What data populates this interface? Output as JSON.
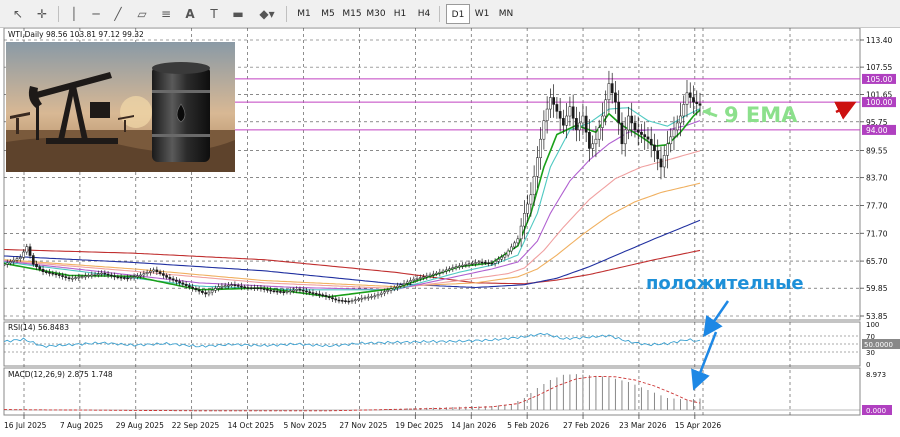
{
  "toolbar": {
    "icons": [
      "cursor-icon",
      "crosshair-icon",
      "vertical-line-icon",
      "horizontal-line-icon",
      "trendline-icon",
      "channel-icon",
      "text-icon",
      "text-label-icon",
      "rectangle-icon",
      "shapes-icon"
    ],
    "timeframes": [
      "M1",
      "M5",
      "M15",
      "M30",
      "H1",
      "H4",
      "D1",
      "W1",
      "MN"
    ],
    "active_timeframe": "D1"
  },
  "chart_header": "WTI,Daily  98.56 103.81 97.12 99.32",
  "annotations": {
    "ema_label": "9 EMA",
    "positive_label": "положителные",
    "ema_color": "#8ce08c",
    "positive_color": "#1e90d8"
  },
  "price_axis": {
    "ticks": [
      "113.40",
      "107.55",
      "101.65",
      "95.75",
      "89.55",
      "83.70",
      "77.70",
      "71.70",
      "65.70",
      "59.85",
      "53.85"
    ],
    "badges": [
      "105.00",
      "100.00",
      "94.00"
    ]
  },
  "rsi": {
    "label": "RSI(14) 56.8483",
    "ticks": [
      "100",
      "70",
      "30",
      "0"
    ],
    "badge": "50.0000"
  },
  "macd": {
    "label": "MACD(12,26,9) 2.875 1.748",
    "ticks": [
      "8.973"
    ],
    "badge": "0.000"
  },
  "time_axis": {
    "labels": [
      "16 Jul 2025",
      "7 Aug 2025",
      "29 Aug 2025",
      "22 Sep 2025",
      "14 Oct 2025",
      "5 Nov 2025",
      "27 Nov 2025",
      "19 Dec 2025",
      "14 Jan 2026",
      "5 Feb 2026",
      "27 Feb 2026",
      "23 Mar 2026",
      "15 Apr 2026"
    ]
  },
  "colors": {
    "horizontal_levels": "#c040c0",
    "badge_fill": "#b040c0",
    "arrow_red": "#cc1111",
    "arrow_blue": "#1e88e5",
    "candle": "#1a1a1a",
    "ema9": "#1aa01a",
    "ema_cyan": "#4fc9c2",
    "ema_violet": "#b060d0",
    "ema_pink": "#f0a0a0",
    "ema_orange": "#f0b060",
    "ema_navy": "#2030a0",
    "ema_red": "#c03030",
    "macd_signal": "#cc3333",
    "rsi_line": "#3aa0d0"
  },
  "chart_data": {
    "type": "line",
    "title": "WTI,Daily",
    "ohlc_header": {
      "open": 98.56,
      "high": 103.81,
      "low": 97.12,
      "close": 99.32
    },
    "x_labels": [
      "16 Jul 2025",
      "7 Aug 2025",
      "29 Aug 2025",
      "22 Sep 2025",
      "14 Oct 2025",
      "5 Nov 2025",
      "27 Nov 2025",
      "19 Dec 2025",
      "14 Jan 2026",
      "5 Feb 2026",
      "27 Feb 2026",
      "23 Mar 2026",
      "15 Apr 2026"
    ],
    "ylim": [
      53.85,
      113.4
    ],
    "levels": [
      105.0,
      100.0,
      94.0
    ],
    "close_path": [
      [
        0,
        65.0
      ],
      [
        5,
        66.5
      ],
      [
        7,
        68.8
      ],
      [
        9,
        65.0
      ],
      [
        12,
        63.4
      ],
      [
        16,
        62.8
      ],
      [
        20,
        61.9
      ],
      [
        26,
        62.6
      ],
      [
        30,
        63.1
      ],
      [
        34,
        62.3
      ],
      [
        38,
        62.0
      ],
      [
        42,
        62.7
      ],
      [
        46,
        63.8
      ],
      [
        50,
        62.2
      ],
      [
        54,
        61.0
      ],
      [
        58,
        59.8
      ],
      [
        62,
        58.6
      ],
      [
        66,
        60.2
      ],
      [
        70,
        60.6
      ],
      [
        74,
        60.0
      ],
      [
        78,
        59.9
      ],
      [
        82,
        59.3
      ],
      [
        86,
        59.0
      ],
      [
        90,
        59.6
      ],
      [
        94,
        58.9
      ],
      [
        98,
        58.3
      ],
      [
        102,
        57.3
      ],
      [
        106,
        57.0
      ],
      [
        110,
        57.7
      ],
      [
        114,
        58.2
      ],
      [
        118,
        59.4
      ],
      [
        122,
        60.6
      ],
      [
        126,
        61.8
      ],
      [
        130,
        62.5
      ],
      [
        134,
        63.3
      ],
      [
        138,
        64.3
      ],
      [
        142,
        65.0
      ],
      [
        146,
        65.5
      ],
      [
        150,
        65.2
      ],
      [
        154,
        67.0
      ],
      [
        158,
        70.5
      ],
      [
        160,
        76.0
      ],
      [
        162,
        80.0
      ],
      [
        164,
        88.0
      ],
      [
        166,
        96.0
      ],
      [
        168,
        101.0
      ],
      [
        170,
        98.0
      ],
      [
        172,
        95.0
      ],
      [
        174,
        99.0
      ],
      [
        176,
        94.0
      ],
      [
        178,
        97.0
      ],
      [
        180,
        90.0
      ],
      [
        182,
        92.0
      ],
      [
        184,
        97.0
      ],
      [
        186,
        104.0
      ],
      [
        188,
        100.0
      ],
      [
        190,
        91.0
      ],
      [
        192,
        97.0
      ],
      [
        194,
        94.0
      ],
      [
        196,
        93.0
      ],
      [
        198,
        92.0
      ],
      [
        200,
        89.5
      ],
      [
        202,
        86.0
      ],
      [
        204,
        91.0
      ],
      [
        206,
        94.0
      ],
      [
        208,
        97.0
      ],
      [
        210,
        102.0
      ],
      [
        212,
        100.0
      ],
      [
        214,
        99.3
      ]
    ],
    "series": [
      {
        "name": "9 EMA",
        "color": "#1aa01a",
        "values": [
          [
            0,
            65.2
          ],
          [
            20,
            62.6
          ],
          [
            40,
            62.4
          ],
          [
            60,
            59.5
          ],
          [
            80,
            59.9
          ],
          [
            100,
            58.0
          ],
          [
            120,
            59.8
          ],
          [
            140,
            64.5
          ],
          [
            150,
            65.3
          ],
          [
            158,
            69.0
          ],
          [
            162,
            76.0
          ],
          [
            166,
            86.0
          ],
          [
            170,
            93.0
          ],
          [
            176,
            95.0
          ],
          [
            182,
            93.5
          ],
          [
            186,
            97.5
          ],
          [
            190,
            95.0
          ],
          [
            196,
            92.5
          ],
          [
            200,
            90.5
          ],
          [
            204,
            90.8
          ],
          [
            208,
            93.5
          ],
          [
            212,
            97.0
          ],
          [
            214,
            98.3
          ]
        ]
      },
      {
        "name": "",
        "color": "#4fc9c2",
        "values": [
          [
            0,
            65.5
          ],
          [
            30,
            62.9
          ],
          [
            60,
            60.3
          ],
          [
            90,
            59.5
          ],
          [
            120,
            59.5
          ],
          [
            140,
            63.3
          ],
          [
            150,
            64.8
          ],
          [
            158,
            67.0
          ],
          [
            164,
            76.0
          ],
          [
            168,
            86.0
          ],
          [
            174,
            94.0
          ],
          [
            180,
            95.5
          ],
          [
            186,
            98.5
          ],
          [
            192,
            98.8
          ],
          [
            198,
            96.0
          ],
          [
            204,
            94.8
          ],
          [
            210,
            97.2
          ],
          [
            214,
            98.6
          ]
        ]
      },
      {
        "name": "",
        "color": "#b060d0",
        "values": [
          [
            0,
            65.7
          ],
          [
            30,
            63.4
          ],
          [
            60,
            61.0
          ],
          [
            90,
            60.0
          ],
          [
            120,
            59.5
          ],
          [
            140,
            62.5
          ],
          [
            150,
            64.0
          ],
          [
            158,
            65.5
          ],
          [
            164,
            70.0
          ],
          [
            168,
            76.0
          ],
          [
            174,
            83.0
          ],
          [
            180,
            87.5
          ],
          [
            186,
            91.0
          ],
          [
            192,
            93.5
          ],
          [
            198,
            94.0
          ],
          [
            204,
            94.0
          ],
          [
            210,
            95.0
          ],
          [
            214,
            96.0
          ]
        ]
      },
      {
        "name": "",
        "color": "#f0a0a0",
        "values": [
          [
            0,
            65.8
          ],
          [
            40,
            63.5
          ],
          [
            80,
            61.0
          ],
          [
            120,
            59.8
          ],
          [
            140,
            61.5
          ],
          [
            155,
            63.0
          ],
          [
            160,
            64.2
          ],
          [
            166,
            68.0
          ],
          [
            172,
            73.0
          ],
          [
            180,
            79.0
          ],
          [
            188,
            83.5
          ],
          [
            196,
            86.0
          ],
          [
            204,
            87.5
          ],
          [
            214,
            89.5
          ]
        ]
      },
      {
        "name": "",
        "color": "#f0b060",
        "values": [
          [
            0,
            66.0
          ],
          [
            40,
            64.0
          ],
          [
            80,
            61.5
          ],
          [
            120,
            60.2
          ],
          [
            145,
            61.0
          ],
          [
            158,
            62.3
          ],
          [
            164,
            64.0
          ],
          [
            170,
            67.0
          ],
          [
            178,
            71.5
          ],
          [
            186,
            75.5
          ],
          [
            194,
            78.5
          ],
          [
            202,
            80.5
          ],
          [
            214,
            82.5
          ]
        ]
      },
      {
        "name": "",
        "color": "#2030a0",
        "values": [
          [
            0,
            66.8
          ],
          [
            40,
            65.4
          ],
          [
            80,
            63.6
          ],
          [
            120,
            60.8
          ],
          [
            145,
            60.0
          ],
          [
            160,
            60.6
          ],
          [
            170,
            62.0
          ],
          [
            180,
            64.5
          ],
          [
            190,
            67.5
          ],
          [
            200,
            70.5
          ],
          [
            214,
            74.5
          ]
        ]
      },
      {
        "name": "",
        "color": "#c03030",
        "values": [
          [
            0,
            68.2
          ],
          [
            40,
            67.4
          ],
          [
            80,
            66.0
          ],
          [
            120,
            63.3
          ],
          [
            145,
            61.0
          ],
          [
            160,
            60.8
          ],
          [
            170,
            61.6
          ],
          [
            180,
            62.8
          ],
          [
            190,
            64.4
          ],
          [
            200,
            66.0
          ],
          [
            214,
            68.0
          ]
        ]
      }
    ],
    "rsi": {
      "ylim": [
        0,
        100
      ],
      "levels": [
        70,
        50,
        30
      ],
      "values": [
        [
          0,
          56
        ],
        [
          6,
          62
        ],
        [
          12,
          44
        ],
        [
          20,
          48
        ],
        [
          30,
          53
        ],
        [
          40,
          47
        ],
        [
          50,
          51
        ],
        [
          60,
          44
        ],
        [
          70,
          49
        ],
        [
          80,
          46
        ],
        [
          90,
          50
        ],
        [
          100,
          45
        ],
        [
          110,
          52
        ],
        [
          120,
          54
        ],
        [
          130,
          56
        ],
        [
          140,
          57
        ],
        [
          150,
          60
        ],
        [
          160,
          68
        ],
        [
          166,
          76
        ],
        [
          172,
          63
        ],
        [
          178,
          66
        ],
        [
          186,
          71
        ],
        [
          192,
          56
        ],
        [
          198,
          48
        ],
        [
          204,
          51
        ],
        [
          210,
          61
        ],
        [
          214,
          56.85
        ]
      ]
    },
    "macd": {
      "ylim": [
        -0.5,
        9.5
      ],
      "hist_points": [
        [
          0,
          0.2
        ],
        [
          60,
          -0.3
        ],
        [
          100,
          -0.2
        ],
        [
          140,
          0.8
        ],
        [
          150,
          1.0
        ],
        [
          156,
          1.5
        ],
        [
          160,
          3.0
        ],
        [
          164,
          5.5
        ],
        [
          168,
          7.5
        ],
        [
          172,
          8.8
        ],
        [
          176,
          8.97
        ],
        [
          180,
          8.7
        ],
        [
          186,
          8.2
        ],
        [
          192,
          7.0
        ],
        [
          198,
          5.0
        ],
        [
          204,
          3.0
        ],
        [
          210,
          2.6
        ],
        [
          214,
          2.875
        ]
      ],
      "signal_points": [
        [
          0,
          0.1
        ],
        [
          60,
          -0.2
        ],
        [
          100,
          -0.2
        ],
        [
          140,
          0.5
        ],
        [
          150,
          0.8
        ],
        [
          158,
          1.6
        ],
        [
          164,
          3.6
        ],
        [
          170,
          6.0
        ],
        [
          176,
          7.8
        ],
        [
          182,
          8.4
        ],
        [
          188,
          8.3
        ],
        [
          194,
          7.5
        ],
        [
          200,
          6.0
        ],
        [
          206,
          4.0
        ],
        [
          210,
          2.5
        ],
        [
          214,
          1.748
        ]
      ]
    }
  }
}
